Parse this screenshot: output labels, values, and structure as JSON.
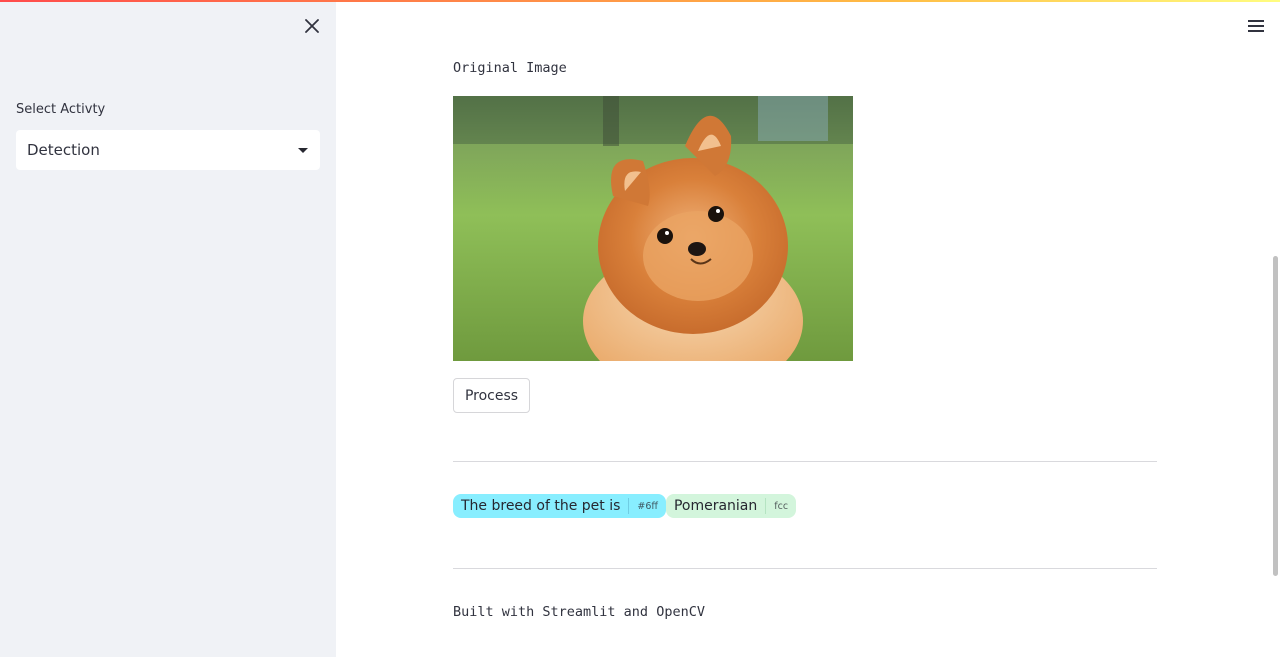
{
  "sidebar": {
    "select_label": "Select Activty",
    "select_value": "Detection"
  },
  "main": {
    "caption_original": "Original Image",
    "process_button": "Process",
    "annotation": {
      "text": "The breed of the pet is",
      "tag": "#6ff",
      "color": "#8ef"
    },
    "result": {
      "text": "Pomeranian",
      "tag": "fcc",
      "color": "#d3f5dc"
    },
    "footer": "Built with Streamlit and OpenCV"
  },
  "icons": {
    "close": "close-icon",
    "menu": "hamburger-menu-icon",
    "dropdown": "caret-down-icon"
  },
  "colors": {
    "sidebar_bg": "#f0f2f6",
    "accent_gradient_start": "#ff4b4b",
    "accent_gradient_end": "#fffd80"
  }
}
